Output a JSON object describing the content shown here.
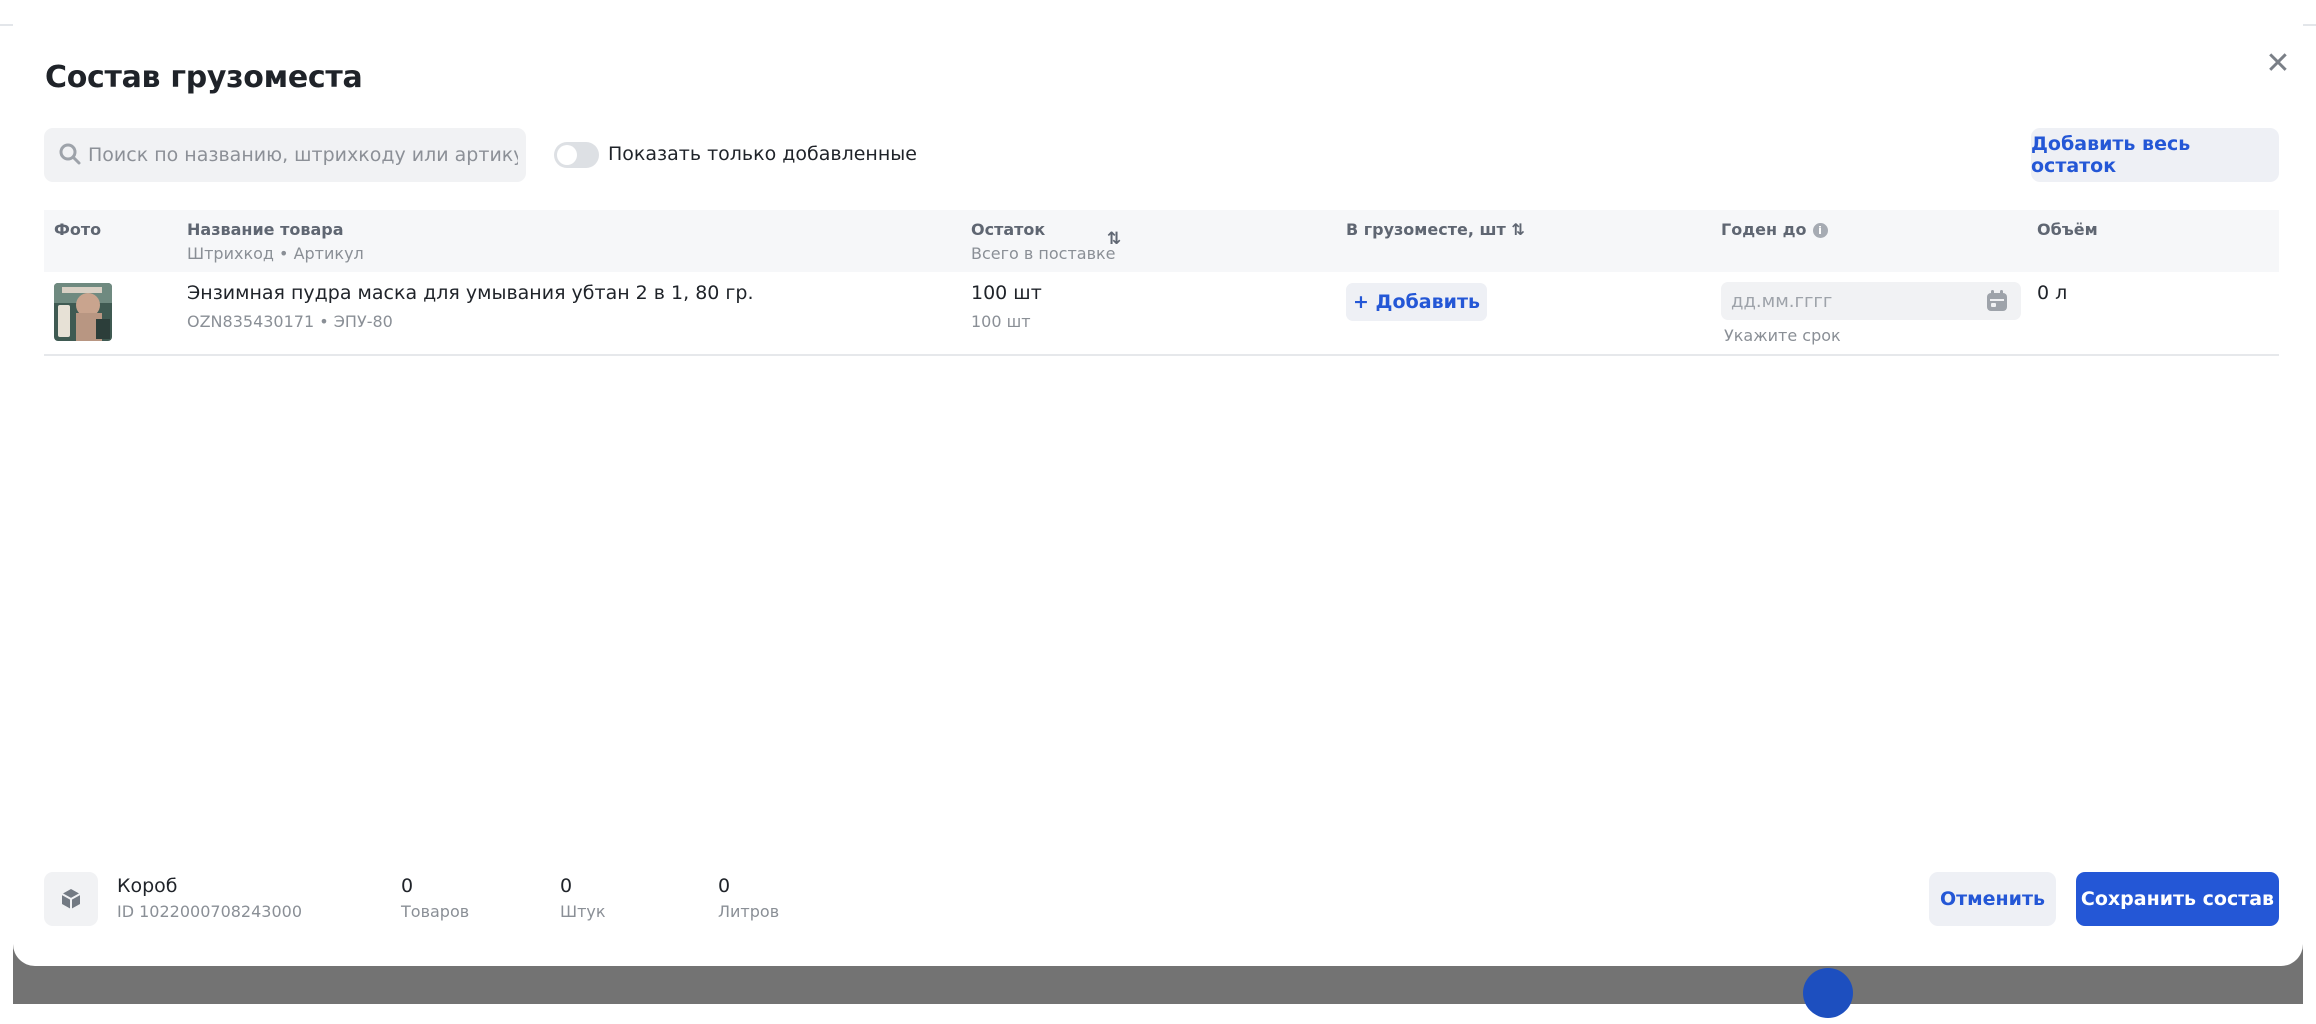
{
  "modal": {
    "title": "Состав грузоместа",
    "close_icon": "close-icon"
  },
  "toolbar": {
    "search_placeholder": "Поиск по названию, штрихкоду или артикулу",
    "toggle_label": "Показать только добавленные",
    "toggle_on": false,
    "add_all_label": "Добавить весь остаток"
  },
  "table": {
    "headers": {
      "photo": "Фото",
      "name": "Название товара",
      "name_sub": "Штрихкод • Артикул",
      "stock": "Остаток",
      "stock_sub": "Всего в поставке",
      "in_box": "В грузоместе, шт",
      "expiry": "Годен до",
      "volume": "Объём"
    },
    "rows": [
      {
        "name": "Энзимная пудра маска для умывания убтан 2 в 1, 80 гр.",
        "meta": "OZN835430171 • ЭПУ-80",
        "stock": "100 шт",
        "stock_total": "100 шт",
        "add_label": "+ Добавить",
        "date_placeholder": "дд.мм.гггг",
        "date_hint": "Укажите срок",
        "volume": "0 л"
      }
    ]
  },
  "footer": {
    "box_name": "Короб",
    "box_id": "ID 1022000708243000",
    "stats": [
      {
        "value": "0",
        "label": "Товаров"
      },
      {
        "value": "0",
        "label": "Штук"
      },
      {
        "value": "0",
        "label": "Литров"
      }
    ],
    "cancel_label": "Отменить",
    "save_label": "Сохранить состав"
  },
  "colors": {
    "accent": "#2457d6",
    "button_secondary_bg": "#eef0f5",
    "muted_text": "#8a8f96"
  }
}
